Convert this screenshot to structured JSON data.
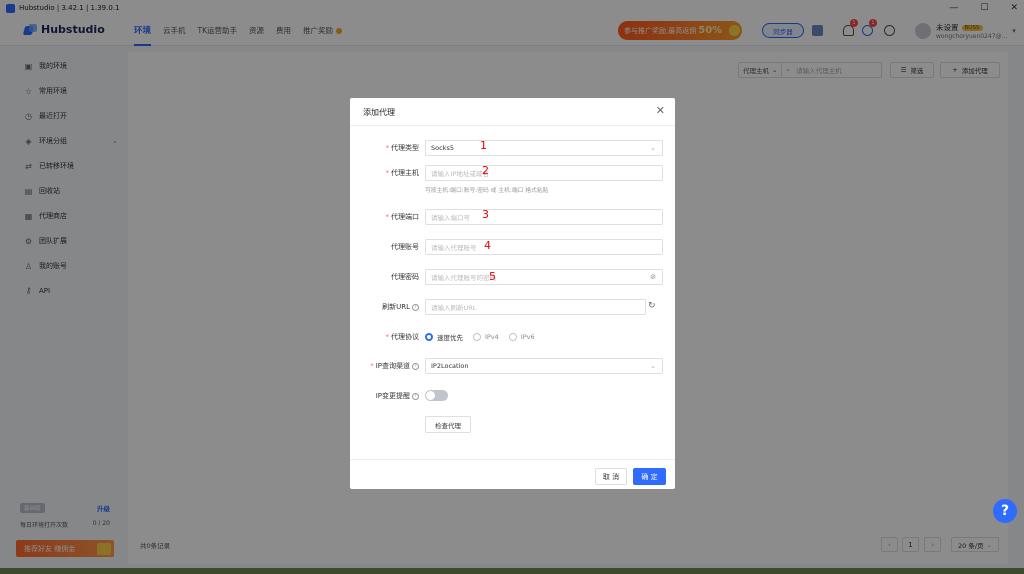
{
  "window": {
    "title": "Hubstudio | 3.42.1 | 1.39.0.1",
    "minimize": "—",
    "maximize": "☐",
    "close": "✕"
  },
  "brand": "Hubstudio",
  "nav": {
    "tabs": [
      "环境",
      "云手机",
      "TK运营助手",
      "资源",
      "费用",
      "推广奖励"
    ],
    "active": "环境",
    "promo_text": "参与推广奖励,最高返佣",
    "promo_highlight": "50%",
    "sync_label": "同步器",
    "notify_badge": "1",
    "download_badge": "1"
  },
  "user": {
    "name": "未设置",
    "plan": "BOSS",
    "email": "wongchoryuen0247@..."
  },
  "sidebar": {
    "items": [
      {
        "label": "我的环境",
        "icon": "box-icon"
      },
      {
        "label": "常用环境",
        "icon": "star-icon"
      },
      {
        "label": "最近打开",
        "icon": "clock-icon"
      },
      {
        "label": "环境分组",
        "icon": "layers-icon"
      },
      {
        "label": "已转移环境",
        "icon": "transfer-icon"
      },
      {
        "label": "回收站",
        "icon": "trash-icon"
      },
      {
        "label": "代理商店",
        "icon": "store-icon"
      },
      {
        "label": "团队扩展",
        "icon": "team-icon"
      },
      {
        "label": "我的账号",
        "icon": "user-icon"
      },
      {
        "label": "API",
        "icon": "api-icon"
      }
    ],
    "upgrade_badge": "基础版",
    "upgrade_link": "升级",
    "daily_opens_label": "每日环境打开次数",
    "daily_opens_value": "0 / 20",
    "referral_banner": "推荐好友 赚佣金"
  },
  "toolbar": {
    "search_type": "代理主机",
    "search_placeholder": "请输入代理主机",
    "filter_label": "筛选",
    "add_label": "添加代理"
  },
  "pagination": {
    "total": "共0条记录",
    "prev": "‹",
    "page": "1",
    "next": "›",
    "page_size": "20 条/页"
  },
  "modal": {
    "title": "添加代理",
    "fields": {
      "type_label": "代理类型",
      "type_value": "Socks5",
      "host_label": "代理主机",
      "host_placeholder": "请输入IP地址或域名",
      "host_hint": "可按主机:端口:账号:密码 或 主机:端口 格式粘贴",
      "port_label": "代理端口",
      "port_placeholder": "请输入端口号",
      "account_label": "代理账号",
      "account_placeholder": "请输入代理账号",
      "password_label": "代理密码",
      "password_placeholder": "请输入代理账号的密码",
      "refresh_label": "刷新URL",
      "refresh_placeholder": "请输入刷新URL",
      "protocol_label": "代理协议",
      "protocol_options": [
        "速度优先",
        "IPv4",
        "IPv6"
      ],
      "protocol_selected": "速度优先",
      "channel_label": "IP查询渠道",
      "channel_value": "IP2Location",
      "ipchange_label": "IP变更提醒",
      "ipchange_on": false
    },
    "check_button": "检查代理",
    "cancel": "取 消",
    "confirm": "确 定"
  },
  "annotations": [
    "1",
    "2",
    "3",
    "4",
    "5"
  ],
  "help": "?",
  "colors": {
    "accent": "#2f6bff",
    "required": "#f56c6c",
    "annotation": "#e00000",
    "promo": "#ff5a1f"
  }
}
